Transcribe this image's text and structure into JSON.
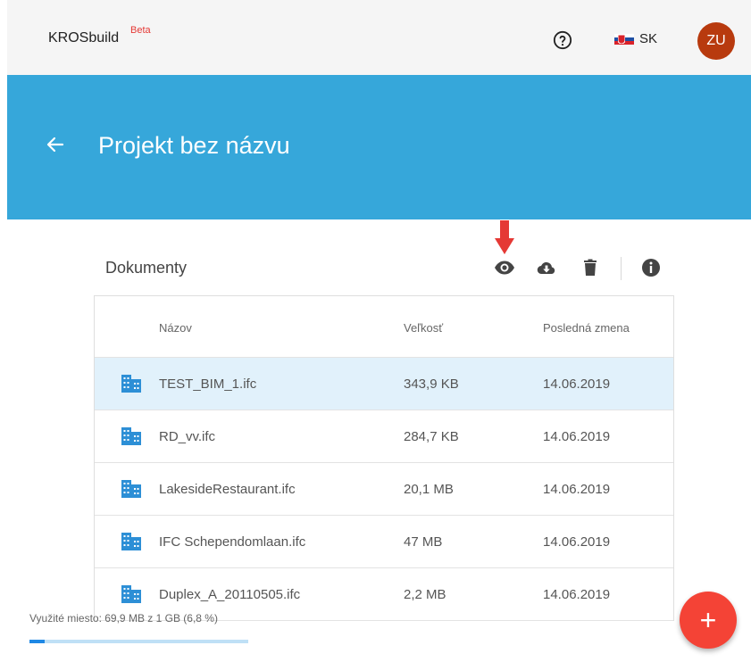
{
  "app": {
    "brand": "KROSbuild",
    "beta": "Beta",
    "lang": "SK",
    "avatar": "ZU"
  },
  "icons": {
    "help": "help-circle-icon",
    "flag": "slovak-flag-icon",
    "back": "arrow-left-icon",
    "view": "eye-icon",
    "download": "cloud-download-icon",
    "delete": "trash-icon",
    "info": "info-icon",
    "arrow": "red-down-arrow-icon",
    "file": "building-icon"
  },
  "colors": {
    "banner": "#36a7da",
    "avatar": "#b83a0e",
    "fab": "#f44336",
    "selected_row": "#e1f1fb",
    "accent_red": "#e53935",
    "progress": "#1e88e5",
    "file_icon": "#2d8fd6"
  },
  "project": {
    "title": "Projekt bez názvu"
  },
  "documents": {
    "label": "Dokumenty",
    "columns": {
      "name": "Názov",
      "size": "Veľkosť",
      "modified": "Posledná zmena"
    },
    "rows": [
      {
        "name": "TEST_BIM_1.ifc",
        "size": "343,9 KB",
        "modified": "14.06.2019",
        "selected": true
      },
      {
        "name": "RD_vv.ifc",
        "size": "284,7 KB",
        "modified": "14.06.2019",
        "selected": false
      },
      {
        "name": "LakesideRestaurant.ifc",
        "size": "20,1 MB",
        "modified": "14.06.2019",
        "selected": false
      },
      {
        "name": "IFC Schependomlaan.ifc",
        "size": "47 MB",
        "modified": "14.06.2019",
        "selected": false
      },
      {
        "name": "Duplex_A_20110505.ifc",
        "size": "2,2 MB",
        "modified": "14.06.2019",
        "selected": false
      }
    ]
  },
  "storage": {
    "text": "Využité miesto: 69,9 MB z 1 GB (6,8 %)",
    "used_fraction": 0.068
  },
  "fab": {
    "label": "+"
  }
}
